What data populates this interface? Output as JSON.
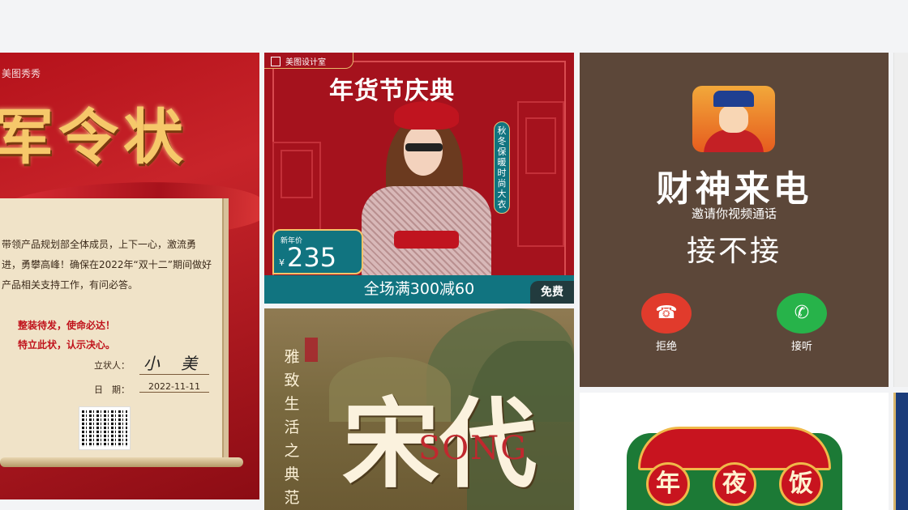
{
  "cards": {
    "military_order": {
      "brand": "美图秀秀",
      "title": "军令状",
      "body": "带领产品规划部全体成员，上下一心，激流勇进，勇攀高峰！确保在2022年“双十二”期间做好产品相关支持工作，有问必答。",
      "oath_line1": "整装待发，使命必达！",
      "oath_line2": "特立此状，认示决心。",
      "signer_label": "立状人：",
      "signer_name": "小 美",
      "date_label": "日　期：",
      "date_value": "2022-11-11"
    },
    "festival": {
      "badge": "美图设计室",
      "title": "年货节庆典",
      "vertical_text": "秋冬保暖时尚大衣",
      "price_label": "新年价",
      "currency": "¥",
      "price": "235",
      "promo": "全场满300减60",
      "free_badge": "免费"
    },
    "song_dynasty": {
      "vertical_text": "雅致生活之典范",
      "song_label": "SONG",
      "big_char": "宋代"
    },
    "incoming_call": {
      "caller": "财神来电",
      "subtitle": "邀请你视频通话",
      "question": "接不接",
      "decline_label": "拒绝",
      "accept_label": "接听"
    },
    "new_year_dinner": {
      "chars": [
        "年",
        "夜",
        "饭"
      ]
    }
  },
  "colors": {
    "page_bg": "#f3f4f6",
    "festival_red": "#a5121d",
    "festival_teal": "#117480",
    "call_bg": "#5c4739",
    "decline_red": "#e13b2c",
    "accept_green": "#27b34a"
  }
}
